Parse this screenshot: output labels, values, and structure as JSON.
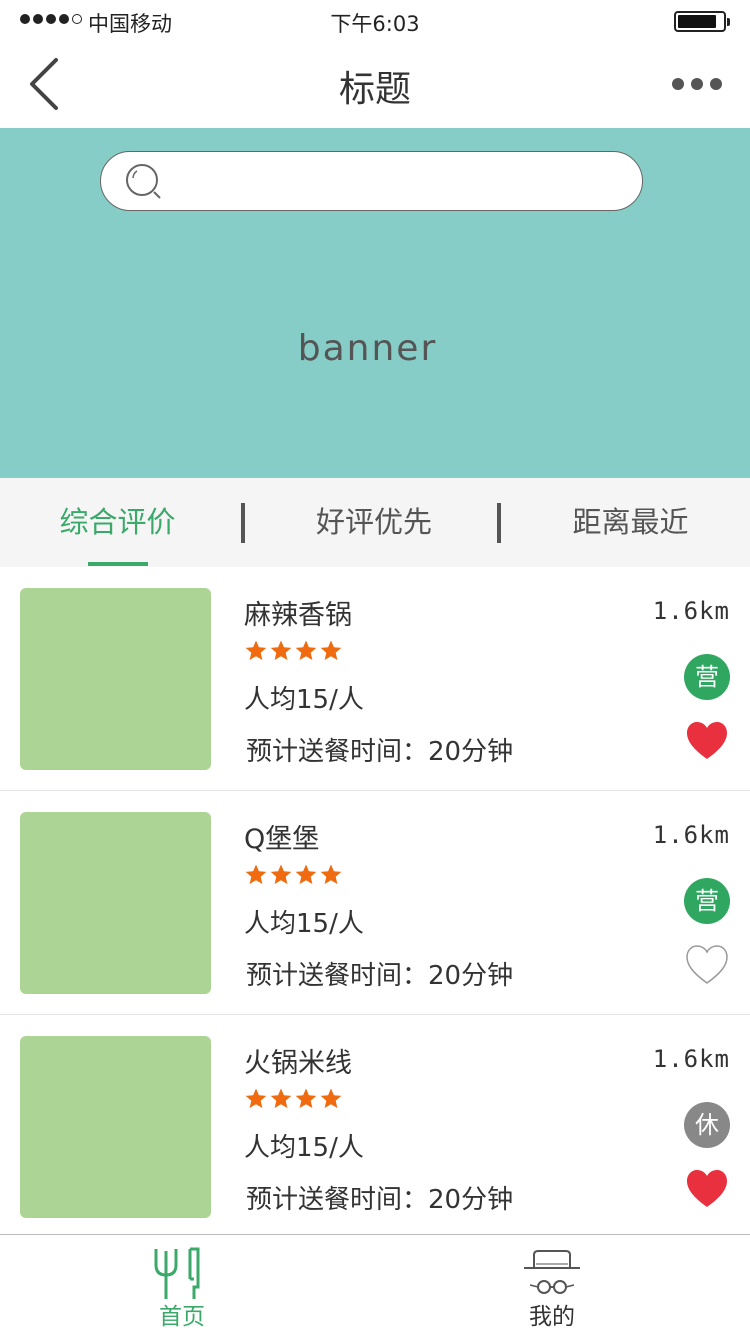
{
  "status_bar": {
    "carrier": "中国移动",
    "time": "下午6:03"
  },
  "nav": {
    "title": "标题"
  },
  "search": {
    "placeholder": ""
  },
  "banner": {
    "label": "banner"
  },
  "sort_tabs": [
    {
      "label": "综合评价",
      "active": true
    },
    {
      "label": "好评优先",
      "active": false
    },
    {
      "label": "距离最近",
      "active": false
    }
  ],
  "shops": [
    {
      "name": "麻辣香锅",
      "rating": 4,
      "avg_price": "人均15/人",
      "eta": "预计送餐时间：20分钟",
      "distance": "1.6km",
      "status": "营",
      "favorited": true
    },
    {
      "name": "Q堡堡",
      "rating": 4,
      "avg_price": "人均15/人",
      "eta": "预计送餐时间：20分钟",
      "distance": "1.6km",
      "status": "营",
      "favorited": false
    },
    {
      "name": "火锅米线",
      "rating": 4,
      "avg_price": "人均15/人",
      "eta": "预计送餐时间：20分钟",
      "distance": "1.6km",
      "status": "休",
      "favorited": true
    }
  ],
  "tab_bar": {
    "home_label": "首页",
    "mine_label": "我的"
  },
  "colors": {
    "accent": "#3aa96a",
    "banner_bg": "#86cdc7",
    "thumb_bg": "#acd595",
    "star": "#f06a0f",
    "heart": "#e8303f",
    "open_badge": "#2fa760",
    "closed_badge": "#888888"
  },
  "icons": {
    "back": "chevron-left-icon",
    "more": "more-dots-icon",
    "search": "search-icon",
    "star": "star-icon",
    "heart": "heart-icon",
    "home": "fork-knife-icon",
    "mine": "user-hat-glasses-icon"
  }
}
